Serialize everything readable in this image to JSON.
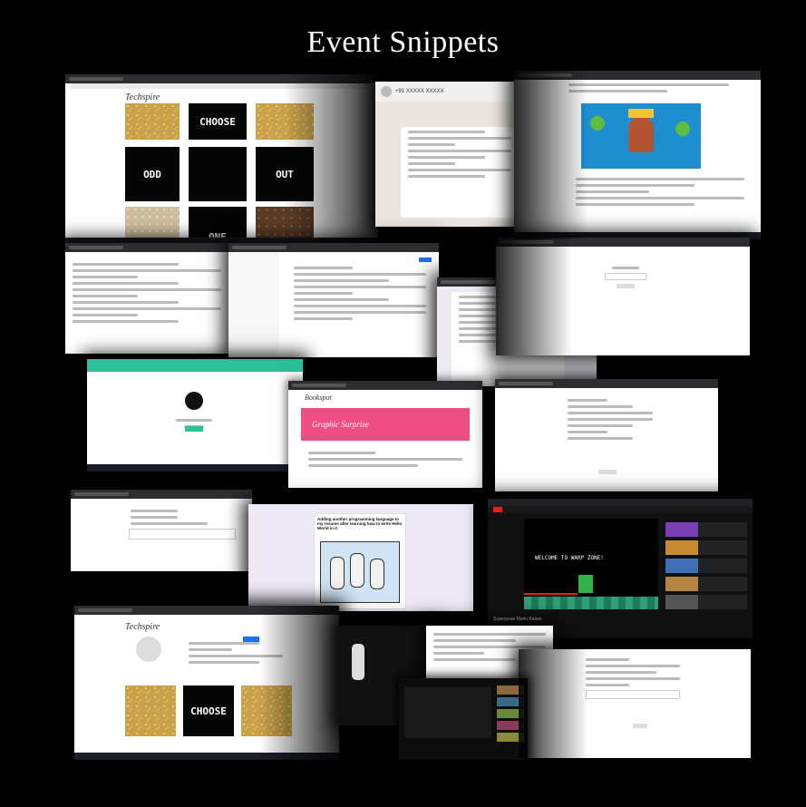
{
  "title": "Event Snippets",
  "colors": {
    "background": "#000000",
    "teal": "#2bbf9a",
    "pink": "#ee4d86",
    "youtube_dark": "#111111"
  },
  "snippets": {
    "puzzle": {
      "logo": "Techspire",
      "tiles": [
        "CHOOSE",
        "ODD",
        "OUT",
        "ONE"
      ]
    },
    "whatsapp": {
      "contact": "+91 XXXXX XXXXX"
    },
    "youtube_game": {
      "screen_text": [
        "WELCOME TO WARP ZONE!"
      ],
      "caption": "Superpose Mario Kaiser"
    },
    "form_banner": {
      "logo": "Bookspot",
      "banner_text": "Graphic Surprise"
    },
    "comic": {
      "headline": "Adding another programming language to my resume after learning how to write Hello World in it."
    },
    "profile": {
      "logo": "Techspire",
      "tile": "CHOOSE"
    }
  }
}
